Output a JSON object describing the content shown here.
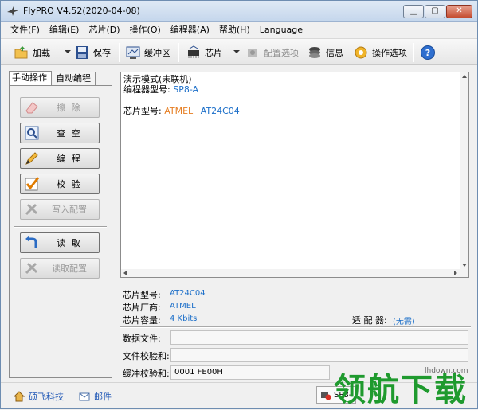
{
  "window": {
    "title": "FlyPRO V4.52(2020-04-08)",
    "min_glyph": "▁",
    "max_glyph": "▢",
    "close_glyph": "✕"
  },
  "menu": [
    "文件(F)",
    "编辑(E)",
    "芯片(D)",
    "操作(O)",
    "编程器(A)",
    "帮助(H)",
    "Language"
  ],
  "toolbar": {
    "load": "加载",
    "save": "保存",
    "buffer": "缓冲区",
    "chip": "芯片",
    "config": "配置选项",
    "info": "信息",
    "options": "操作选项"
  },
  "tabs": {
    "manual": "手动操作",
    "auto": "自动编程"
  },
  "actions": {
    "erase": "擦 除",
    "blank_check": "查 空",
    "program": "编 程",
    "verify": "校 验",
    "write_config": "写入配置",
    "read": "读 取",
    "read_config": "读取配置"
  },
  "log": {
    "line1": "演示模式(未联机)",
    "line2_label": "编程器型号:",
    "line2_value": "SP8-A",
    "line3_label": "芯片型号:",
    "line3_vendor": "ATMEL",
    "line3_chip": "AT24C04"
  },
  "info": {
    "chip_model_label": "芯片型号:",
    "chip_model_value": "AT24C04",
    "vendor_label": "芯片厂商:",
    "vendor_value": "ATMEL",
    "capacity_label": "芯片容量:",
    "capacity_value": "4 Kbits",
    "adapter_label": "适 配 器:",
    "adapter_value": "(无需)"
  },
  "fields": {
    "data_file_label": "数据文件:",
    "data_file_value": "",
    "file_checksum_label": "文件校验和:",
    "file_checksum_value": "",
    "buffer_checksum_label": "缓冲校验和:",
    "buffer_checksum_value": "0001 FE00H"
  },
  "status": {
    "company": "硕飞科技",
    "mail": "邮件",
    "programmer": "SP8-"
  },
  "watermark": {
    "text": "领航下载",
    "url": "lhdown.com"
  },
  "colors": {
    "accent_blue": "#1c6fc9",
    "vendor_orange": "#e67e22",
    "watermark_green": "#1f9a2e"
  }
}
